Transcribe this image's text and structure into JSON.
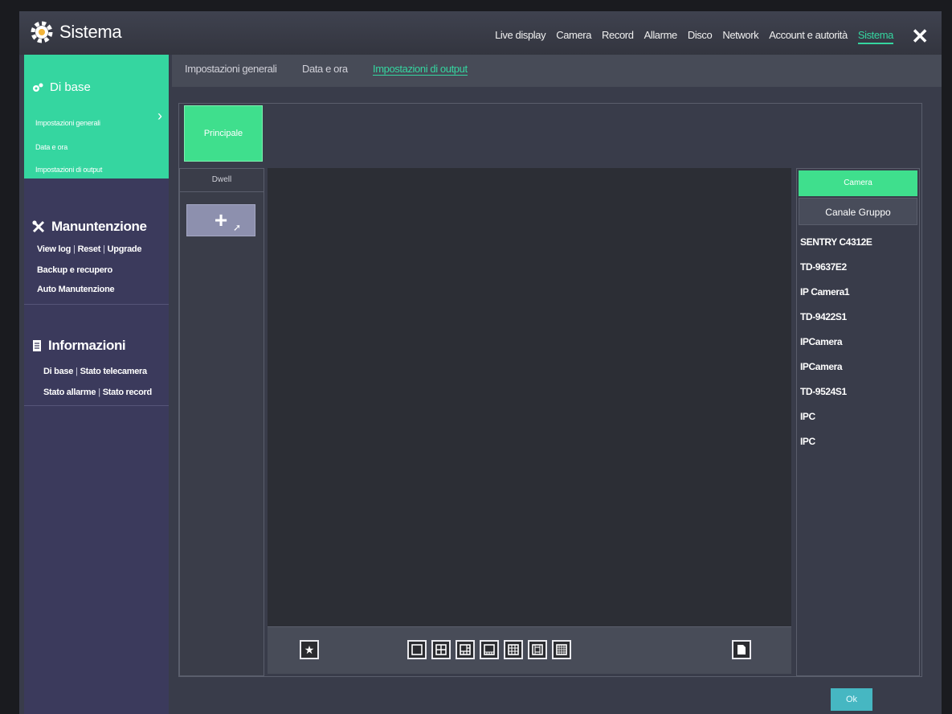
{
  "header": {
    "title": "Sistema",
    "nav": [
      "Live display",
      "Camera",
      "Record",
      "Allarme",
      "Disco",
      "Network",
      "Account e autorità",
      "Sistema"
    ],
    "active_nav": "Sistema"
  },
  "sidebar": {
    "base": {
      "title": "Di base",
      "items": [
        "Impostazioni generali",
        "Data e ora",
        "Impostazioni di output"
      ]
    },
    "maintenance": {
      "title": "Manuntenzione",
      "links_row1": [
        "View log",
        "Reset",
        "Upgrade"
      ],
      "line2": "Backup e recupero",
      "line3": "Auto Manutenzione"
    },
    "info": {
      "title": "Informazioni",
      "links_row1": [
        "Di base",
        "Stato telecamera"
      ],
      "links_row2": [
        "Stato allarme",
        "Stato record"
      ]
    }
  },
  "tabs": [
    "Impostazioni generali",
    "Data e ora",
    "Impostazioni di output"
  ],
  "active_tab": "Impostazioni di output",
  "output": {
    "screen_button": "Principale",
    "dwell_label": "Dwell",
    "add_icon": "plus-icon",
    "camera_tab": "Camera",
    "group_tab": "Canale Gruppo",
    "cameras": [
      "SENTRY C4312E",
      "TD-9637E2",
      "IP Camera1",
      "TD-9422S1",
      "IPCamera",
      "IPCamera",
      "TD-9524S1",
      "IPC",
      "IPC"
    ],
    "layout_icons": [
      "layout-1-icon",
      "layout-4-icon",
      "layout-6-icon",
      "layout-8-icon",
      "layout-9-icon",
      "layout-13-icon",
      "layout-16-icon"
    ],
    "favorite_icon": "star-icon",
    "clear_icon": "clear-icon"
  },
  "footer": {
    "ok_label": "Ok"
  },
  "colors": {
    "accent": "#35d6a0",
    "sidebar": "#3b3a5c",
    "ok": "#46b7c2"
  }
}
